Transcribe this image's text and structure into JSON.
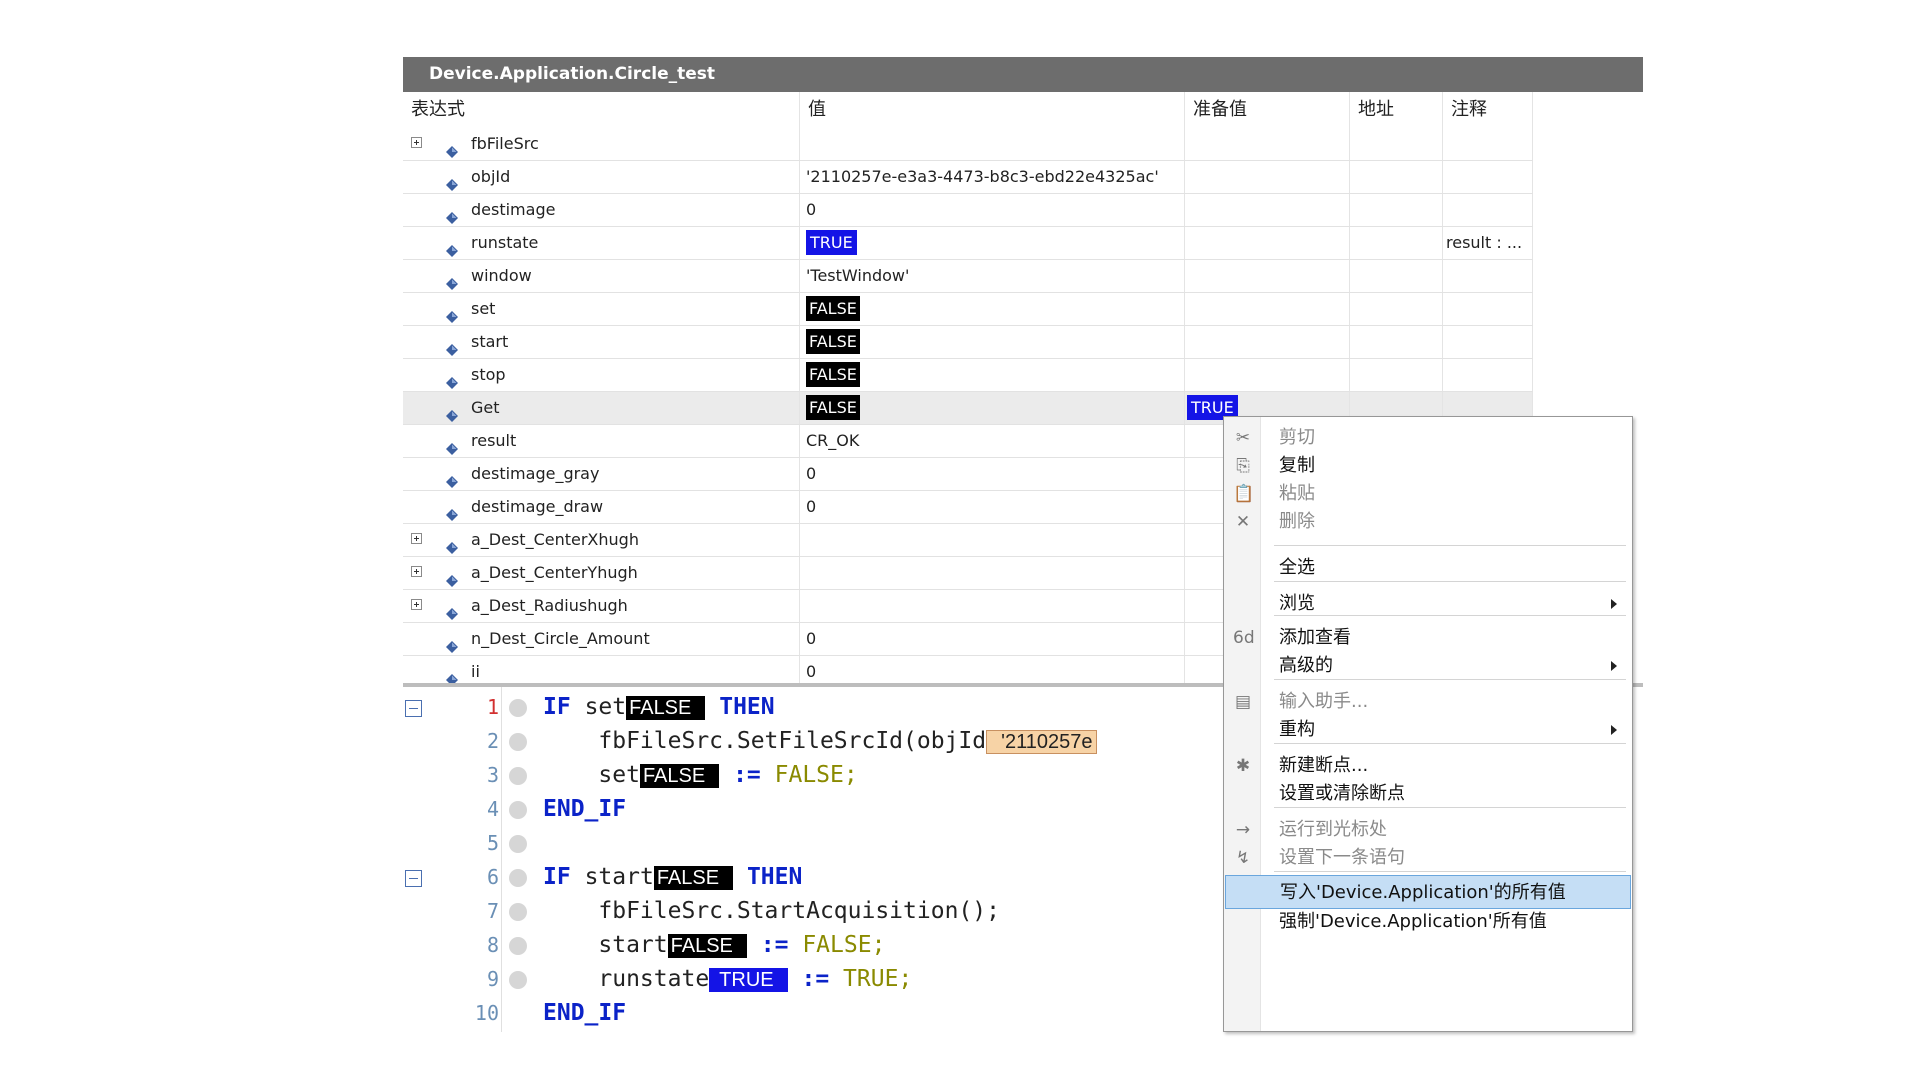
{
  "window": {
    "title": "Device.Application.Circle_test"
  },
  "watch": {
    "headers": {
      "expression": "表达式",
      "value": "值",
      "prepared": "准备值",
      "address": "地址",
      "comment": "注释"
    },
    "rows": [
      {
        "name": "fbFileSrc",
        "expandable": true,
        "value": "",
        "prepared": "",
        "comment": ""
      },
      {
        "name": "objId",
        "value": "'2110257e-e3a3-4473-b8c3-ebd22e4325ac'",
        "prepared": "",
        "comment": ""
      },
      {
        "name": "destimage",
        "value": "0",
        "prepared": "",
        "comment": ""
      },
      {
        "name": "runstate",
        "value": "TRUE",
        "value_style": "true",
        "prepared": "",
        "comment": "result : ..."
      },
      {
        "name": "window",
        "value": "'TestWindow'",
        "prepared": "",
        "comment": ""
      },
      {
        "name": "set",
        "value": "FALSE",
        "value_style": "false",
        "prepared": "",
        "comment": ""
      },
      {
        "name": "start",
        "value": "FALSE",
        "value_style": "false",
        "prepared": "",
        "comment": ""
      },
      {
        "name": "stop",
        "value": "FALSE",
        "value_style": "false",
        "prepared": "",
        "comment": ""
      },
      {
        "name": "Get",
        "value": "FALSE",
        "value_style": "false",
        "prepared": "TRUE",
        "highlight": true,
        "comment": ""
      },
      {
        "name": "result",
        "value": "CR_OK",
        "prepared": "",
        "comment": ""
      },
      {
        "name": "destimage_gray",
        "value": "0",
        "prepared": "",
        "comment": ""
      },
      {
        "name": "destimage_draw",
        "value": "0",
        "prepared": "",
        "comment": ""
      },
      {
        "name": "a_Dest_CenterXhugh",
        "expandable": true,
        "value": "",
        "prepared": "",
        "comment": ""
      },
      {
        "name": "a_Dest_CenterYhugh",
        "expandable": true,
        "value": "",
        "prepared": "",
        "comment": ""
      },
      {
        "name": "a_Dest_Radiushugh",
        "expandable": true,
        "value": "",
        "prepared": "",
        "comment": ""
      },
      {
        "name": "n_Dest_Circle_Amount",
        "value": "0",
        "prepared": "",
        "comment": ""
      },
      {
        "name": "ii",
        "value": "0",
        "prepared": "",
        "comment": ""
      }
    ]
  },
  "code": {
    "lines": [
      {
        "num": "1",
        "kw_if": "IF",
        "ident": "set",
        "mon": "FALSE",
        "kw_then": "THEN"
      },
      {
        "num": "2",
        "call": "fbFileSrc.SetFileSrcId(objId",
        "mon": "'2110257e"
      },
      {
        "num": "3",
        "ident": "set",
        "mon": "FALSE",
        "op": ":=",
        "lit": "FALSE;"
      },
      {
        "num": "4",
        "kw": "END_IF"
      },
      {
        "num": "5"
      },
      {
        "num": "6",
        "kw_if": "IF",
        "ident": "start",
        "mon": "FALSE",
        "kw_then": "THEN"
      },
      {
        "num": "7",
        "call": "fbFileSrc.StartAcquisition();"
      },
      {
        "num": "8",
        "ident": "start",
        "mon": "FALSE",
        "op": ":=",
        "lit": "FALSE;"
      },
      {
        "num": "9",
        "ident": "runstate",
        "mon": "TRUE",
        "op": ":=",
        "lit": "TRUE;"
      },
      {
        "num": "10",
        "kw": "END_IF"
      }
    ]
  },
  "context_menu": {
    "items": [
      {
        "label": "剪切",
        "icon": "scissors-icon",
        "enabled": false
      },
      {
        "label": "复制",
        "icon": "copy-icon",
        "enabled": true
      },
      {
        "label": "粘贴",
        "icon": "paste-icon",
        "enabled": false
      },
      {
        "label": "删除",
        "icon": "delete-icon",
        "enabled": false
      },
      {
        "label": "全选",
        "enabled": true
      },
      {
        "label": "浏览",
        "enabled": true,
        "submenu": true
      },
      {
        "label": "添加查看",
        "icon": "glasses-icon",
        "enabled": true
      },
      {
        "label": "高级的",
        "enabled": true,
        "submenu": true
      },
      {
        "label": "输入助手...",
        "icon": "input-assistant-icon",
        "enabled": false
      },
      {
        "label": "重构",
        "enabled": true,
        "submenu": true
      },
      {
        "label": "新建断点...",
        "icon": "new-breakpoint-icon",
        "enabled": true
      },
      {
        "label": "设置或清除断点",
        "enabled": true
      },
      {
        "label": "运行到光标处",
        "icon": "run-to-cursor-icon",
        "enabled": false
      },
      {
        "label": "设置下一条语句",
        "icon": "next-statement-icon",
        "enabled": false
      },
      {
        "label": "写入'Device.Application'的所有值",
        "enabled": true,
        "selected": true
      },
      {
        "label": "强制'Device.Application'所有值",
        "enabled": true
      }
    ]
  },
  "colors": {
    "true_bg": "#1414e6",
    "false_bg": "#000000",
    "keyword": "#0b23c8",
    "literal": "#8a8a00",
    "selection": "#c5def5"
  }
}
